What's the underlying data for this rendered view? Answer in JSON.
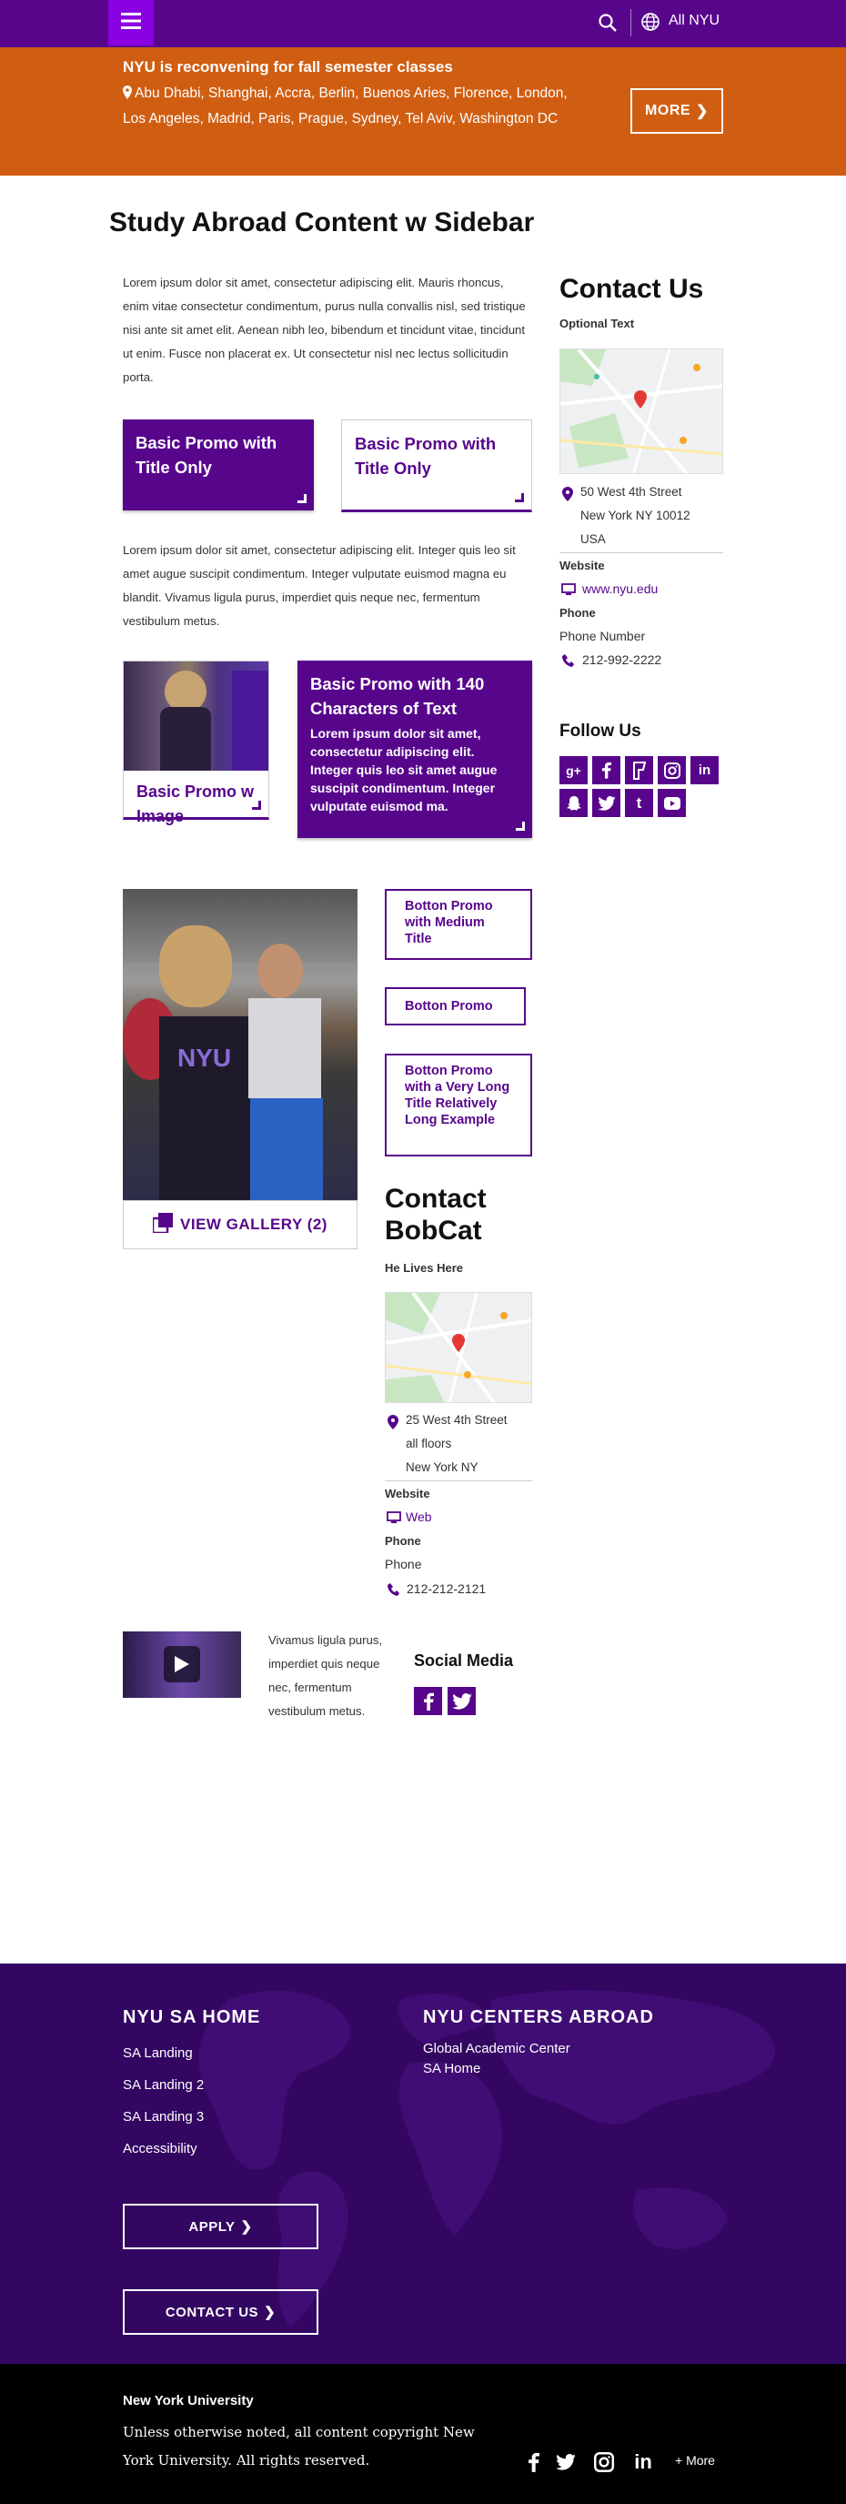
{
  "header": {
    "all_nyu": "All NYU"
  },
  "alert": {
    "title": "NYU is reconvening for fall semester classes",
    "cities": "Abu Dhabi, Shanghai, Accra, Berlin, Buenos Aries, Florence, London, Los Angeles, Madrid, Paris, Prague, Sydney, Tel Aviv, Washington DC",
    "more_label": "MORE"
  },
  "page": {
    "title": "Study Abroad Content w Sidebar",
    "para1": "Lorem ipsum dolor sit amet, consectetur adipiscing elit. Mauris rhoncus, enim vitae consectetur condimentum, purus nulla convallis nisl, sed tristique nisi ante sit amet elit. Aenean nibh leo, bibendum et tincidunt vitae, tincidunt ut enim. Fusce non placerat ex. Ut consectetur nisl nec lectus sollicitudin porta.",
    "promo1_title": "Basic Promo with Title Only",
    "promo2_title": "Basic Promo with Title Only",
    "para2": "Lorem ipsum dolor sit amet, consectetur adipiscing elit. Integer quis leo sit amet augue suscipit condimentum. Integer vulputate euismod magna eu blandit. Vivamus ligula purus, imperdiet quis neque nec, fermentum vestibulum metus.",
    "promo_image_title": "Basic Promo w Image",
    "promo140_title": "Basic Promo with 140 Characters of Text",
    "promo140_text": "Lorem ipsum dolor sit amet, consectetur adipiscing elit. Integer quis leo sit amet augue suscipit condimentum. Integer vulputate euismod ma.",
    "gallery_label": "VIEW GALLERY (2)",
    "btn_medium": "Botton Promo with Medium Title",
    "btn_short": "Botton Promo",
    "btn_long": "Botton Promo with a Very Long Title Relatively Long Example",
    "video_text": "Vivamus ligula purus, imperdiet quis neque nec, fermentum vestibulum metus.",
    "social_media_title": "Social Media"
  },
  "contact_bobcat": {
    "title": "Contact BobCat",
    "subtitle": "He Lives Here",
    "address": [
      "25 West 4th Street",
      "all floors",
      "New York NY"
    ],
    "website_label": "Website",
    "website_link": "Web",
    "phone_label": "Phone",
    "phone_name": "Phone",
    "phone": "212-212-2121"
  },
  "sidebar": {
    "contact_title": "Contact Us",
    "optional": "Optional Text",
    "address": [
      "50 West 4th Street",
      "New York NY 10012",
      "USA"
    ],
    "website_label": "Website",
    "website": "www.nyu.edu",
    "phone_label": "Phone",
    "phone_name": "Phone Number",
    "phone": "212-992-2222",
    "follow_title": "Follow Us"
  },
  "footer": {
    "col1_title": "NYU SA HOME",
    "col1_links": [
      "SA Landing",
      "SA Landing 2",
      "SA Landing 3",
      "Accessibility"
    ],
    "col2_title": "NYU CENTERS ABROAD",
    "col2_links": [
      "Global Academic Center",
      "SA Home"
    ],
    "apply_label": "APPLY",
    "contact_label": "CONTACT US"
  },
  "bottom": {
    "org": "New York University",
    "copyright": "Unless otherwise noted, all content copyright New York University. All rights reserved.",
    "more_label": "+ More"
  },
  "icons": {
    "menu": "hamburger-icon",
    "search": "search-icon",
    "globe": "globe-icon",
    "pin": "map-pin-icon",
    "phone": "phone-icon",
    "gallery": "gallery-icon",
    "play": "play-icon"
  },
  "colors": {
    "brand_purple": "#57068c",
    "menu_purple": "#8900e1",
    "alert_orange": "#d05e12",
    "footer_purple": "#330662"
  }
}
